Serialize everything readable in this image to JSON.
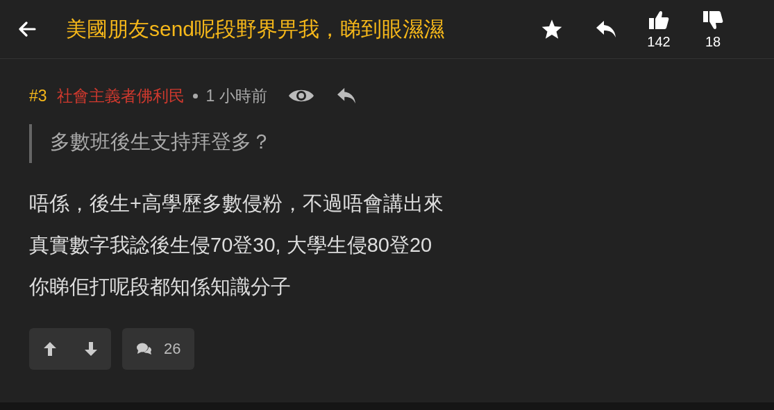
{
  "header": {
    "title": "美國朋友send呢段野界畀我，睇到眼濕濕",
    "likes": "142",
    "dislikes": "18"
  },
  "post": {
    "number": "#3",
    "author": "社會主義者佛利民",
    "time": "1 小時前",
    "quote": "多數班後生支持拜登多？",
    "body": [
      "唔係，後生+高學歷多數侵粉，不過唔會講出來",
      "真實數字我諗後生侵70登30, 大學生侵80登20",
      "你睇佢打呢段都知係知識分子"
    ],
    "comment_count": "26"
  }
}
